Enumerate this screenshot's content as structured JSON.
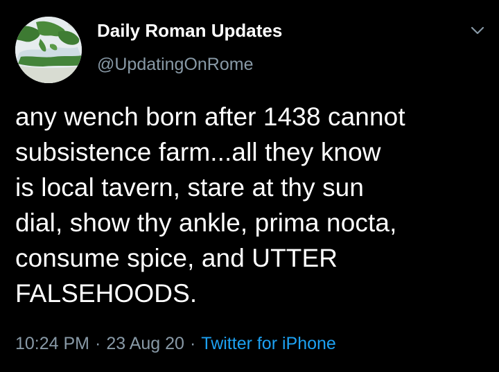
{
  "user": {
    "display_name": "Daily Roman Updates",
    "handle": "@UpdatingOnRome",
    "avatar_icon": "roman-empire-map-avatar"
  },
  "more_icon": "chevron-down-icon",
  "tweet": {
    "text": "any wench born after 1438 cannot\nsubsistence farm...all they know\nis local tavern, stare at thy sun\ndial, show thy ankle, prima nocta,\nconsume spice, and UTTER\nFALSEHOODS."
  },
  "meta": {
    "time": "10:24 PM",
    "separator": "·",
    "date": "23 Aug 20",
    "source": "Twitter for iPhone"
  },
  "colors": {
    "background": "#000000",
    "text": "#ffffff",
    "secondary": "#8899a6",
    "accent": "#1da1f2"
  }
}
